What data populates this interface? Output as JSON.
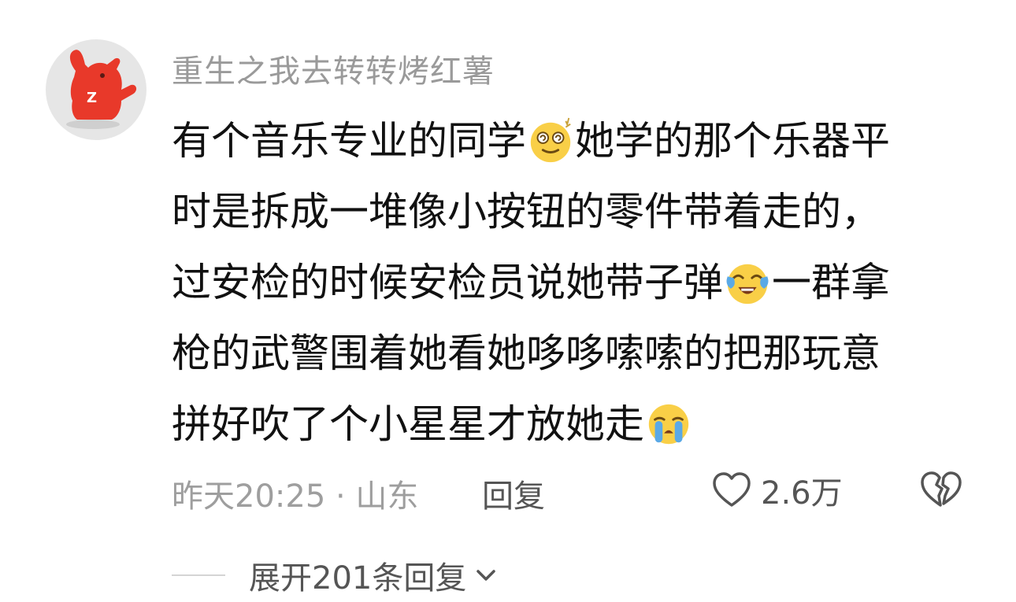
{
  "comment": {
    "username": "重生之我去转转烤红薯",
    "lines": [
      [
        "有个音乐专业的同学",
        "她学的那个乐器平"
      ],
      [
        "时是拆成一堆像小按钮的零件带着走的，"
      ],
      [
        "过安检的时候安检员说她带子弹",
        "一群拿"
      ],
      [
        "枪的武警围着她看她哆哆嗦嗦的把那玩意"
      ],
      [
        "拼好吹了个小星星才放她走"
      ]
    ],
    "emojis": [
      "dizzy-face-emoji",
      "crying-laughing-emoji",
      "loudly-crying-emoji"
    ],
    "timestamp": "昨天20:25 · 山东",
    "reply_label": "回复",
    "like_count": "2.6万",
    "expand_label": "展开201条回复"
  },
  "colors": {
    "username": "#9a9a9a",
    "body_text": "#111111",
    "meta": "#9e9e9e",
    "action": "#555555",
    "avatar_mascot": "#e8392a"
  }
}
